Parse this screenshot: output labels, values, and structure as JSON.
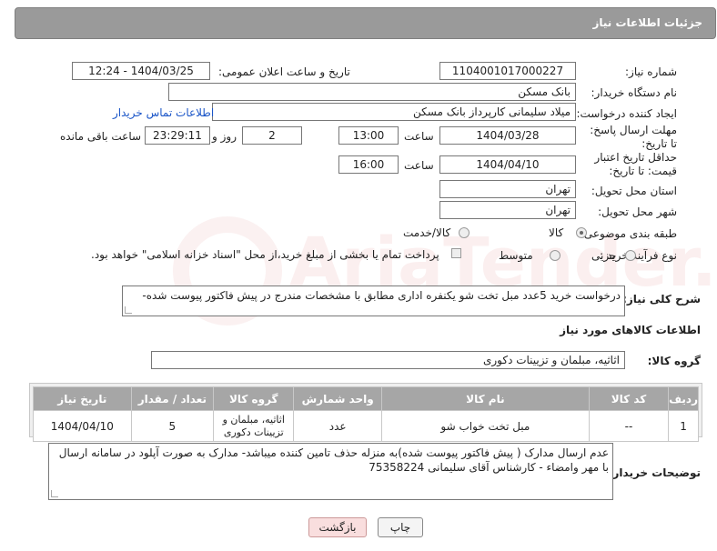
{
  "header": {
    "title": "جزئیات اطلاعات نیاز"
  },
  "fields": {
    "need_number_label": "شماره نیاز:",
    "need_number": "1104001017000227",
    "announce_label": "تاریخ و ساعت اعلان عمومی:",
    "announce_value": "1404/03/25 - 12:24",
    "buyer_org_label": "نام دستگاه خریدار:",
    "buyer_org": "بانک مسکن",
    "creator_label": "ایجاد کننده درخواست:",
    "creator": "میلاد سلیمانی کارپرداز بانک مسکن",
    "contact_link": "اطلاعات تماس خریدار",
    "reply_label": "مهلت ارسال پاسخ: تا تاریخ:",
    "reply_date": "1404/03/28",
    "time_label": "ساعت",
    "reply_time": "13:00",
    "days_value": "2",
    "days_label": "روز و",
    "remaining_time": "23:29:11",
    "remaining_label": "ساعت باقی مانده",
    "price_valid_label": "حداقل تاریخ اعتبار قیمت: تا تاریخ:",
    "price_valid_date": "1404/04/10",
    "price_valid_time": "16:00",
    "province_label": "استان محل تحویل:",
    "province": "تهران",
    "city_label": "شهر محل تحویل:",
    "city": "تهران",
    "category_label": "طبقه بندی موضوعی:",
    "category_options": [
      "کالا",
      "کالا/خدمت"
    ],
    "purchase_type_label": "نوع فرآیند خرید :",
    "purchase_options": [
      "جزیی",
      "متوسط"
    ],
    "payment_note": "پرداخت تمام یا بخشی از مبلغ خرید،از محل \"اسناد خزانه اسلامی\" خواهد بود.",
    "desc_label": "شرح کلی نیاز:",
    "desc": "درخواست خرید 5عدد  مبل تخت شو یکنفره اداری مطابق با مشخصات مندرج در پیش فاکتور پیوست شده-",
    "goods_section_title": "اطلاعات کالاهای مورد نیاز",
    "goods_group_label": "گروه کالا:",
    "goods_group": "اثاثیه، مبلمان و تزیینات دکوری"
  },
  "table": {
    "headers": [
      "ردیف",
      "کد کالا",
      "نام کالا",
      "واحد شمارش",
      "گروه کالا",
      "تعداد / مقدار",
      "تاریخ نیاز"
    ],
    "rows": [
      [
        "1",
        "--",
        "مبل تخت خواب شو",
        "عدد",
        "اثاثیه، مبلمان و تزیینات دکوری",
        "5",
        "1404/04/10"
      ]
    ]
  },
  "notes": {
    "label": "توضیحات خریدار:",
    "text": "عدم ارسال مدارک ( پیش فاکتور پیوست شده)به منزله حذف تامین کننده میباشد- مدارک به صورت آپلود در سامانه ارسال با مهر وامضاء - کارشناس آقای سلیمانی  75358224"
  },
  "buttons": {
    "print": "چاپ",
    "back": "بازگشت"
  },
  "watermark": {
    "text": "AriaTender.net"
  }
}
